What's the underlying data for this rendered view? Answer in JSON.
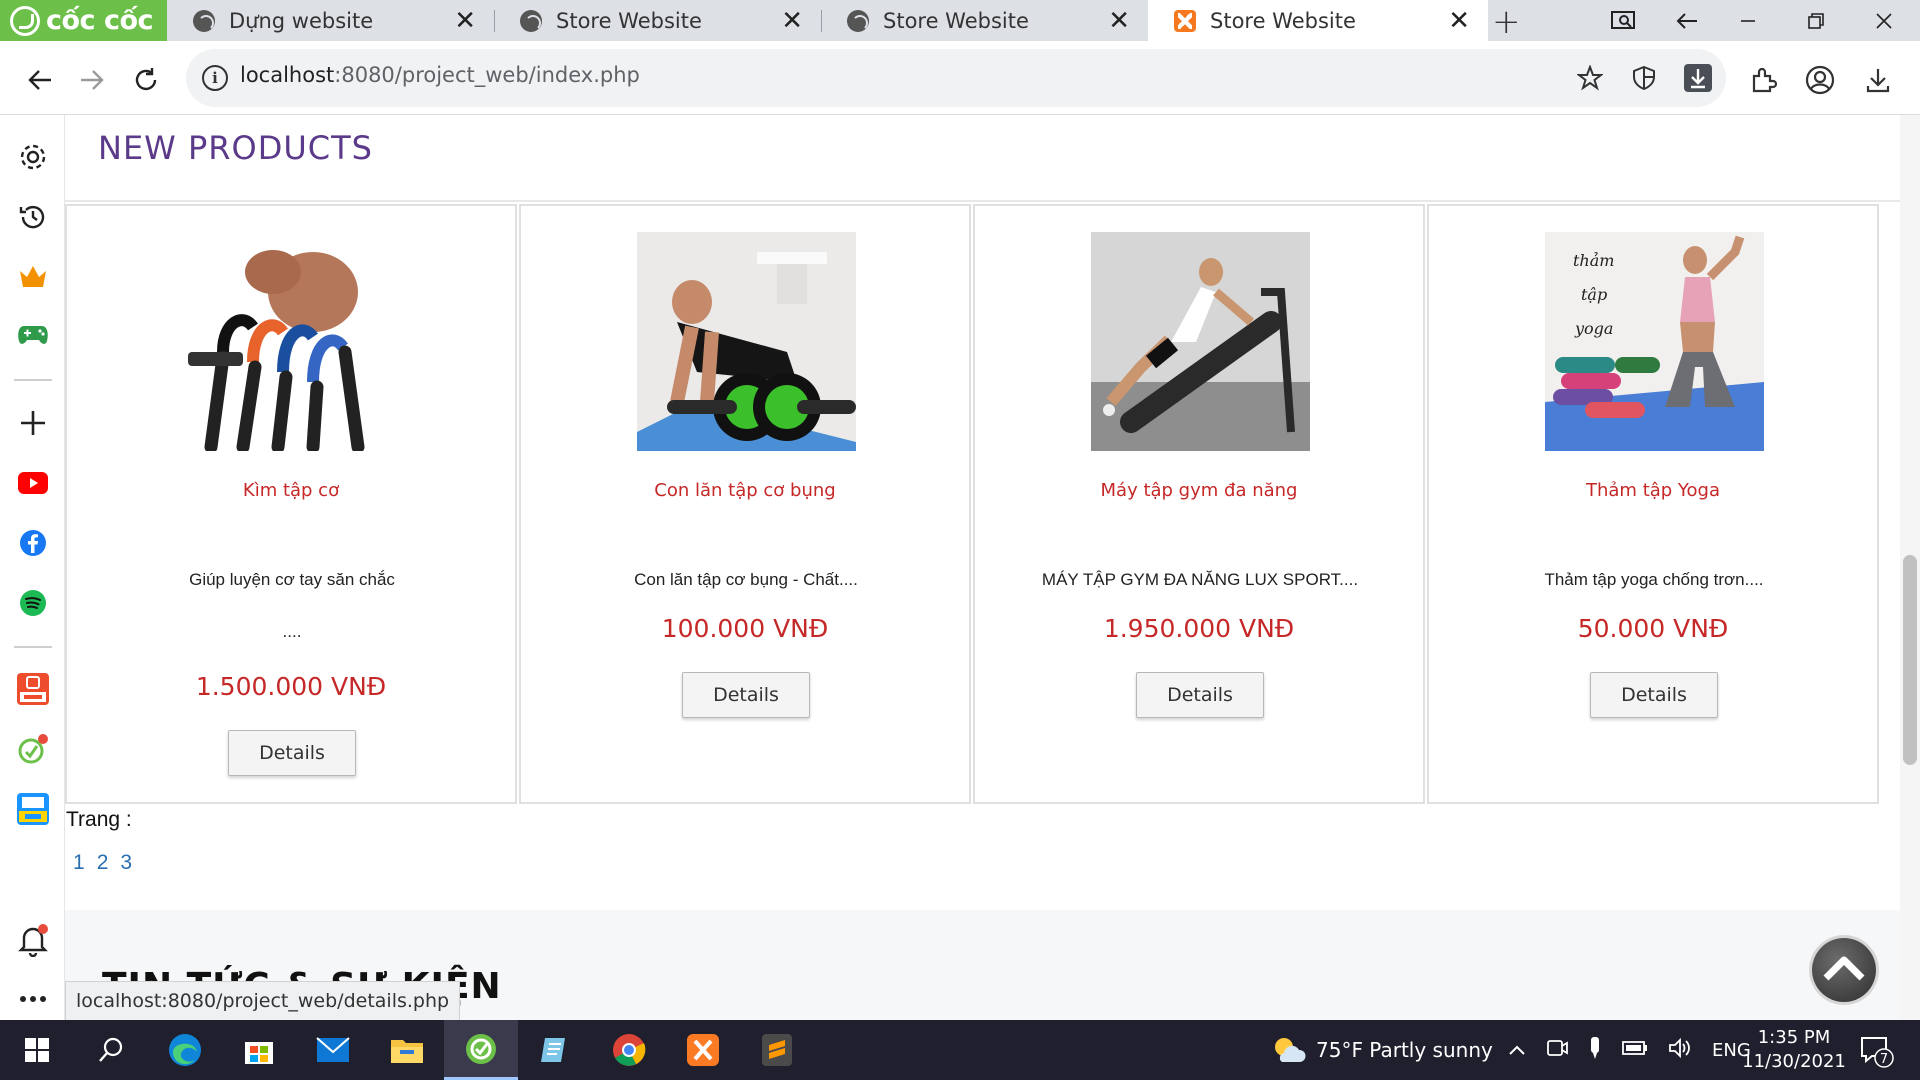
{
  "browser": {
    "brand": "cốc cốc",
    "tabs": [
      {
        "title": "Dựng website",
        "active": false
      },
      {
        "title": "Store Website",
        "active": false
      },
      {
        "title": "Store Website",
        "active": false
      },
      {
        "title": "Store Website",
        "active": true
      }
    ],
    "close_glyph": "✕",
    "new_tab_glyph": "+",
    "address": {
      "host": "localhost",
      "path": ":8080/project_web/index.php"
    },
    "status_url": "localhost:8080/project_web/details.php"
  },
  "page": {
    "section_title": "NEW PRODUCTS",
    "products": [
      {
        "name": "Kìm tập cơ",
        "description": "Giúp luyện cơ tay săn chắc",
        "description_extra": "....",
        "price": "1.500.000 VNĐ",
        "button": "Details"
      },
      {
        "name": "Con lăn tập cơ bụng",
        "description": "Con lăn tập cơ bụng - Chất....",
        "description_extra": "",
        "price": "100.000 VNĐ",
        "button": "Details"
      },
      {
        "name": "Máy tập gym đa năng",
        "description": "MÁY TẬP GYM ĐA NĂNG LUX SPORT....",
        "description_extra": "",
        "price": "1.950.000 VNĐ",
        "button": "Details"
      },
      {
        "name": "Thảm tập Yoga",
        "description": "Thảm tập yoga chống trơn....",
        "description_extra": "",
        "price": "50.000 VNĐ",
        "button": "Details"
      }
    ],
    "yoga_image_text": [
      "thảm",
      "tập",
      "yoga"
    ],
    "pagination_label": "Trang :",
    "pages": [
      "1",
      "2",
      "3"
    ],
    "news_title": "TIN TỨC & SỰ KIỆN"
  },
  "taskbar": {
    "weather": "75°F  Partly sunny",
    "language": "ENG",
    "time": "1:35 PM",
    "date": "11/30/2021",
    "notifications": "7"
  },
  "colors": {
    "brand_green": "#6cc04a",
    "title_purple": "#5b3a8a",
    "price_red": "#c62828",
    "link_blue": "#2a6fb0"
  }
}
